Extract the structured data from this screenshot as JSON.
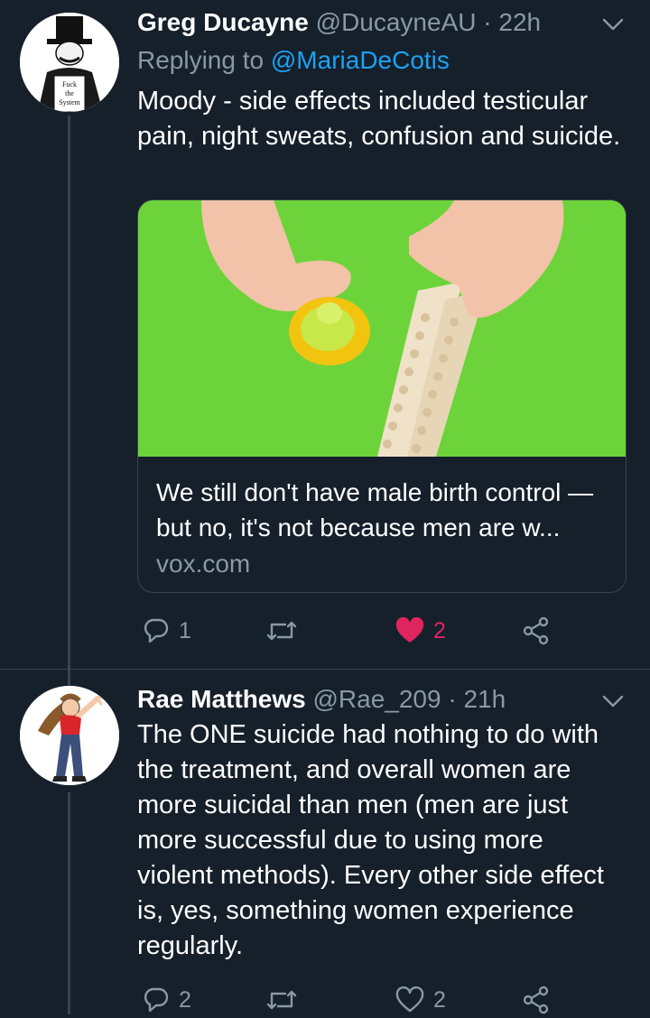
{
  "colors": {
    "background": "#15202b",
    "text_primary": "#ffffff",
    "text_secondary": "#8899a6",
    "link": "#1da1f2",
    "like_active": "#e0245e",
    "border": "#38444d"
  },
  "tweets": [
    {
      "name": "Greg Ducayne",
      "handle": "@DucayneAU",
      "separator": "·",
      "time": "22h",
      "replying_label": "Replying to",
      "replying_handle": "@MariaDeCotis",
      "text": "Moody - side effects included testicular pain, night sweats, confusion and suicide.",
      "avatar_text": [
        "Fuck",
        "the",
        "System"
      ],
      "card": {
        "title": "We still don't have male birth control — but no, it's not because men are w...",
        "domain": "vox.com"
      },
      "actions": {
        "reply_icon": "reply-icon",
        "reply_count": "1",
        "retweet_icon": "retweet-icon",
        "retweet_count": "",
        "like_icon": "heart-filled-icon",
        "like_count": "2",
        "share_icon": "share-icon"
      }
    },
    {
      "name": "Rae Matthews",
      "handle": "@Rae_209",
      "separator": "·",
      "time": "21h",
      "text": "The ONE suicide had nothing to do with the treatment, and overall women are more suicidal than men (men are just more successful due to using more violent methods). Every other side effect is, yes, something women experience regularly.",
      "actions": {
        "reply_icon": "reply-icon",
        "reply_count": "2",
        "retweet_icon": "retweet-icon",
        "retweet_count": "",
        "like_icon": "heart-outline-icon",
        "like_count": "2",
        "share_icon": "share-icon"
      }
    }
  ]
}
